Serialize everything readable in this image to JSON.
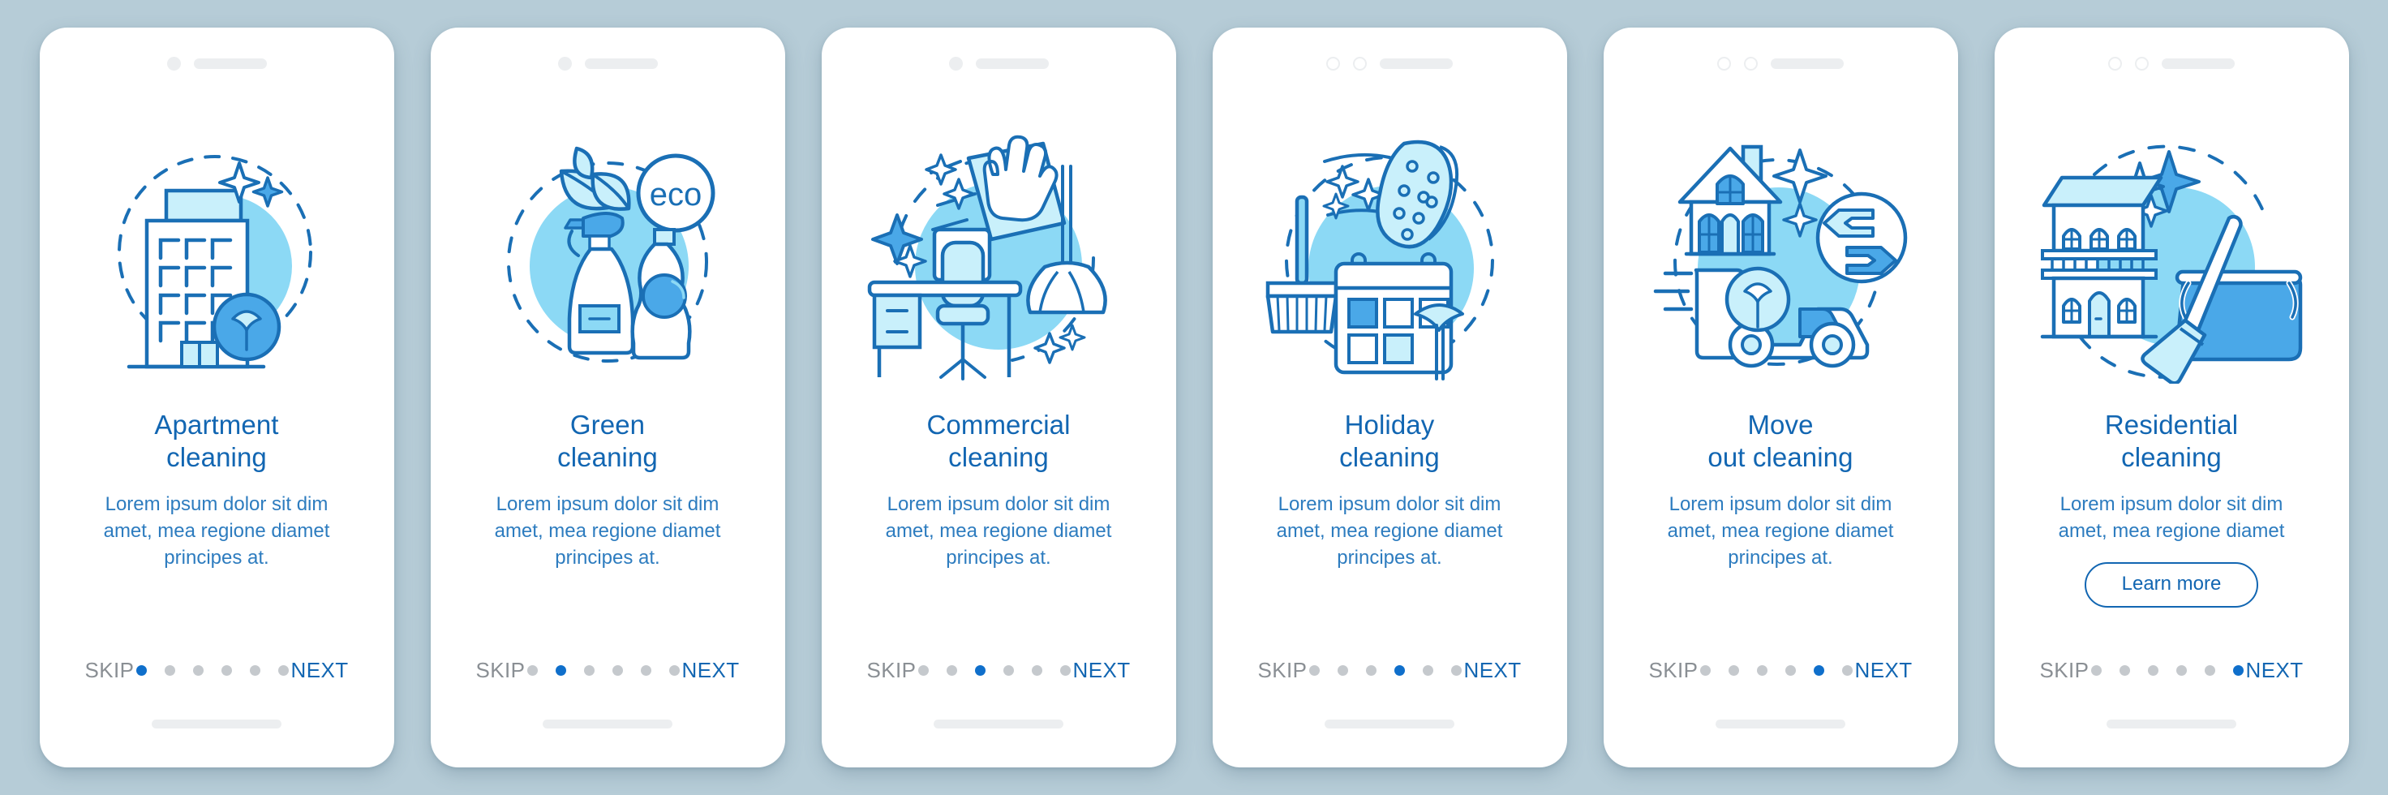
{
  "background_color": "#b6ccd7",
  "theme": {
    "title_color": "#1266b2",
    "body_color": "#2d7cbf",
    "skip_color": "#8a8f94",
    "next_color": "#1266b2",
    "dot_active_color": "#0f6fcb",
    "dot_inactive_color": "#c5c9cd",
    "illustration_stroke": "#1a6fb5",
    "illustration_fill_light": "#c9f0fb",
    "illustration_fill_mid": "#8cd9f5",
    "illustration_fill_accent": "#4aa8e8"
  },
  "common": {
    "skip_label": "SKIP",
    "next_label": "NEXT",
    "body_text": "Lorem ipsum dolor sit dim\namet, mea regione diamet\nprincipes at.",
    "body_text_short": "Lorem ipsum dolor sit dim\namet, mea regione diamet",
    "total_dots": 6
  },
  "screens": [
    {
      "id": "apartment-cleaning",
      "title": "Apartment\ncleaning",
      "body": "Lorem ipsum dolor sit dim\namet, mea regione diamet\nprincipes at.",
      "active_dot": 1,
      "camera_style": "dot",
      "illustration": "apartment-building-with-sparkles-and-duster-badge",
      "has_learn_more": false,
      "learn_more_label": ""
    },
    {
      "id": "green-cleaning",
      "title": "Green\ncleaning",
      "body": "Lorem ipsum dolor sit dim\namet, mea regione diamet\nprincipes at.",
      "active_dot": 2,
      "camera_style": "dot",
      "illustration": "spray-bottle-detergent-leaves-eco-badge",
      "badge_text": "eco",
      "has_learn_more": false,
      "learn_more_label": ""
    },
    {
      "id": "commercial-cleaning",
      "title": "Commercial\ncleaning",
      "body": "Lorem ipsum dolor sit dim\namet, mea regione diamet\nprincipes at.",
      "active_dot": 3,
      "camera_style": "dot",
      "illustration": "office-desk-chair-mop-hand-wiping-cloth",
      "has_learn_more": false,
      "learn_more_label": ""
    },
    {
      "id": "holiday-cleaning",
      "title": "Holiday\ncleaning",
      "body": "Lorem ipsum dolor sit dim\namet, mea regione diamet\nprincipes at.",
      "active_dot": 4,
      "camera_style": "rings",
      "illustration": "broom-sponge-calendar-duster",
      "has_learn_more": false,
      "learn_more_label": ""
    },
    {
      "id": "move-out-cleaning",
      "title": "Move\nout cleaning",
      "body": "Lorem ipsum dolor sit dim\namet, mea regione diamet\nprincipes at.",
      "active_dot": 5,
      "camera_style": "rings",
      "illustration": "house-moving-truck-exchange-arrows",
      "has_learn_more": false,
      "learn_more_label": ""
    },
    {
      "id": "residential-cleaning",
      "title": "Residential\ncleaning",
      "body": "Lorem ipsum dolor sit dim\namet, mea regione diamet",
      "active_dot": 6,
      "camera_style": "rings",
      "illustration": "two-storey-house-broom-bucket-sparkles",
      "has_learn_more": true,
      "learn_more_label": "Learn more"
    }
  ]
}
